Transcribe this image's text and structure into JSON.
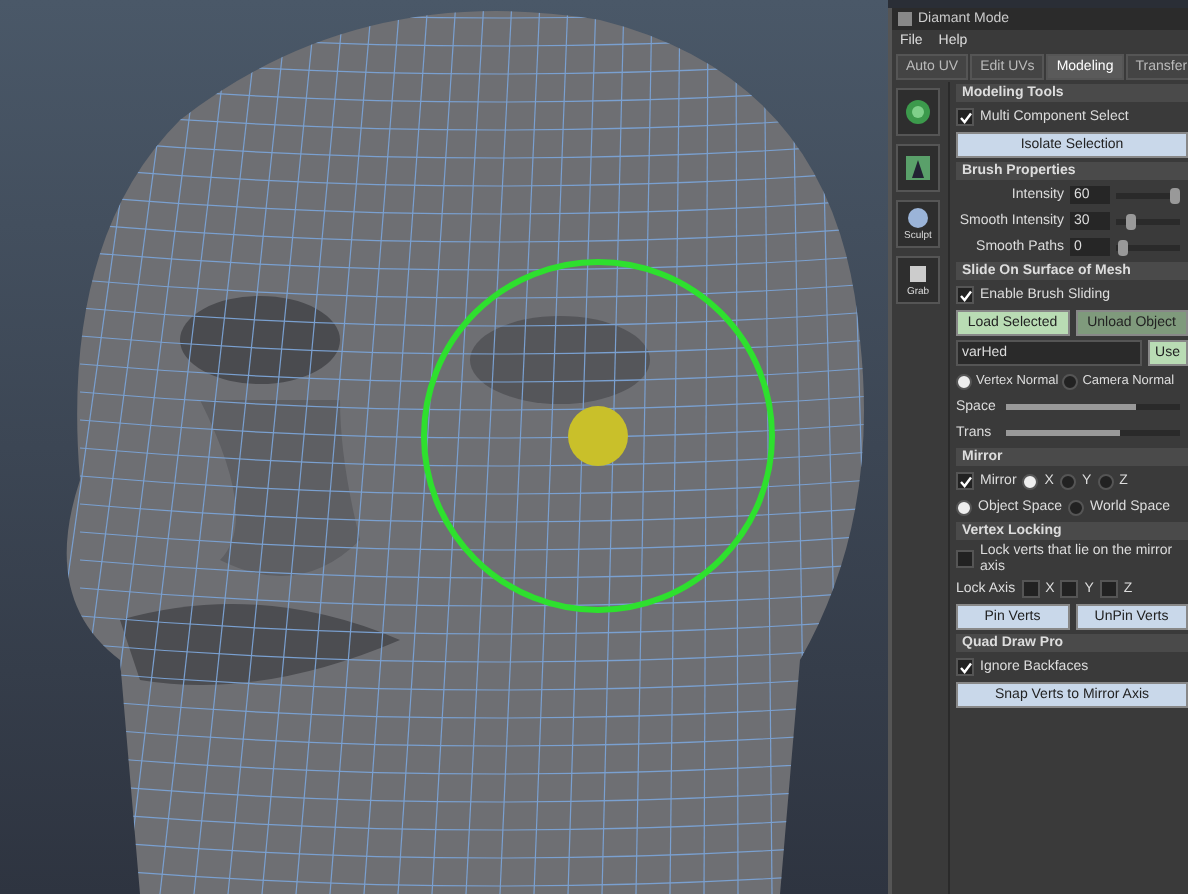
{
  "window": {
    "title": "Diamant Mode"
  },
  "menu": [
    "File",
    "Help"
  ],
  "tabs": [
    {
      "label": "Auto UV",
      "selected": false
    },
    {
      "label": "Edit UVs",
      "selected": false
    },
    {
      "label": "Modeling",
      "selected": true
    },
    {
      "label": "Transfer",
      "selected": false
    }
  ],
  "tools": [
    {
      "kind": "swirl"
    },
    {
      "kind": "pin"
    },
    {
      "kind": "sphere",
      "label": "Sculpt"
    },
    {
      "kind": "cube",
      "label": "Grab"
    }
  ],
  "modeling_tools": {
    "title": "Modeling Tools",
    "multi_component_select": {
      "label": "Multi Component Select",
      "checked": true
    },
    "isolate_button": "Isolate Selection"
  },
  "brush_properties": {
    "title": "Brush Properties",
    "fields": [
      {
        "label": "Intensity",
        "value": "60",
        "level": 1.0
      },
      {
        "label": "Smooth Intensity",
        "value": "30",
        "level": 0.2
      },
      {
        "label": "Smooth Paths",
        "value": "0",
        "level": 0.05
      }
    ]
  },
  "slide": {
    "title": "Slide On Surface of Mesh",
    "enable": {
      "label": "Enable Brush Sliding",
      "checked": true
    },
    "buttons": [
      "Load Selected",
      "Unload Object"
    ],
    "object_field": {
      "value": "varHed"
    },
    "use_button": "Use",
    "normals": [
      {
        "label": "Vertex Normal",
        "selected": true
      },
      {
        "label": "Camera Normal",
        "selected": false
      }
    ],
    "sliders": [
      {
        "label": "Space",
        "level": 0.75
      },
      {
        "label": "Trans",
        "level": 0.65
      }
    ]
  },
  "mirror": {
    "title": "Mirror",
    "mirror": {
      "label": "Mirror",
      "checked": true
    },
    "axes": [
      {
        "label": "X",
        "selected": true
      },
      {
        "label": "Y",
        "selected": false
      },
      {
        "label": "Z",
        "selected": false
      }
    ],
    "spaces": [
      {
        "label": "Object Space",
        "selected": true
      },
      {
        "label": "World Space",
        "selected": false
      }
    ]
  },
  "vertex_locking": {
    "title": "Vertex Locking",
    "lock_mirror": {
      "label": "Lock verts that lie on the mirror axis",
      "checked": false
    },
    "lock_axis_label": "Lock Axis",
    "lock_axes": [
      {
        "label": "X",
        "checked": false
      },
      {
        "label": "Y",
        "checked": false
      },
      {
        "label": "Z",
        "checked": false
      }
    ],
    "buttons": [
      "Pin Verts",
      "UnPin Verts"
    ]
  },
  "quad_draw": {
    "title": "Quad Draw Pro",
    "ignore_backfaces": {
      "label": "Ignore Backfaces",
      "checked": true
    },
    "button": "Snap Verts to Mirror Axis"
  }
}
